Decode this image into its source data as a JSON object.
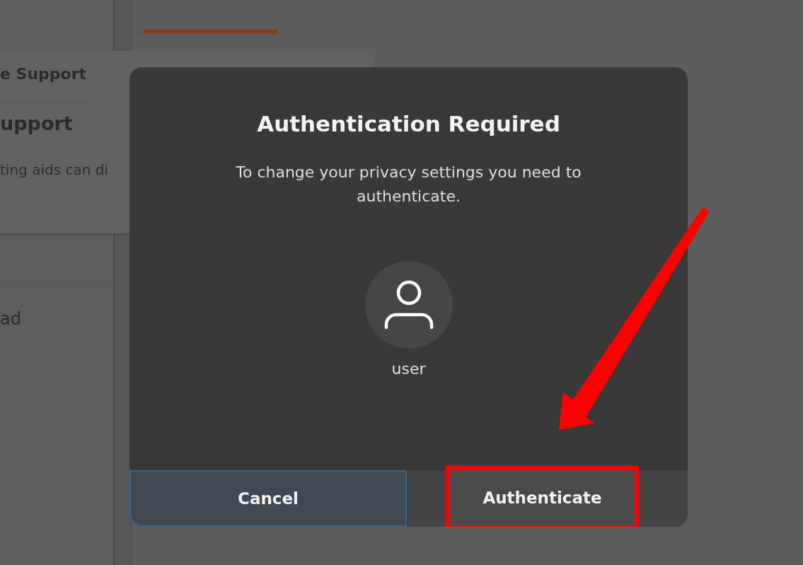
{
  "background": {
    "support_window": {
      "title": "e Support",
      "heading": "upport",
      "text": "ting aids can di"
    },
    "sidebar_item": "ad"
  },
  "dialog": {
    "title": "Authentication Required",
    "message": "To change your privacy settings you need to authenticate.",
    "user": "user",
    "buttons": [
      {
        "label": "Cancel",
        "focused": true,
        "highlighted": false
      },
      {
        "label": "Authenticate",
        "focused": false,
        "highlighted": true
      }
    ]
  },
  "annotation": {
    "kind": "arrow"
  }
}
